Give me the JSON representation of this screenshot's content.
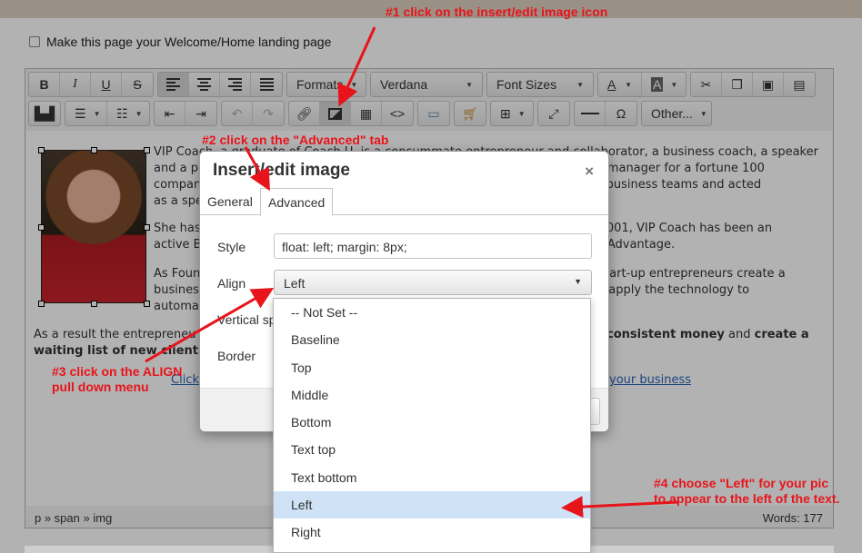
{
  "annotations": {
    "step1": "#1 click on the insert/edit image icon",
    "step2": "#2 click on the \"Advanced\" tab",
    "step3_line1": "#3 click on the ALIGN",
    "step3_line2": "pull down menu",
    "step4_line1": "#4 choose \"Left\" for your pic",
    "step4_line2": "to appear to the left of the text.",
    "color": "#e8141b"
  },
  "page": {
    "welcome_checkbox_label": "Make this page your Welcome/Home landing page"
  },
  "toolbar": {
    "formats_label": "Formats",
    "font_family_value": "Verdana",
    "font_sizes_label": "Font Sizes",
    "other_label": "Other...",
    "bold_label": "B",
    "italic_label": "I",
    "underline_label": "U",
    "strikethrough_label": "S",
    "text_color_label": "A",
    "bg_color_label": "A",
    "code_label": "<>",
    "special_char_label": "Ω"
  },
  "content": {
    "para1": "VIP Coach, a graduate of Coach U, is a consummate entrepreneur and collaborator, a business coach, a speaker and a p... orate HR manager for a fortune 100 compan... anaged business teams and acted as a spe...",
    "para1_lines": [
      "VIP Coach, a graduate of Coach U, is a consummate entrepreneur and collaborator, a business coach, a speaker",
      "and a p                                                                                              orate HR manager for a fortune 100",
      "compan                                                                                               anaged business teams and acted",
      "as a spe"
    ],
    "para2_lines": [
      "She has                                                                                                          2001, VIP Coach has been an",
      "active B                                                                                                         g Advantage."
    ],
    "para3_lines": [
      "As Foun                                                                                                          start-up entrepreneurs create a",
      "busines                                                                                                          d apply the technology to",
      "automa"
    ],
    "para4_start": "As a result the entrepreneu",
    "para4_bold1": "consistent money",
    "para4_mid": " and ",
    "para4_bold2": "create a",
    "para4_line2_bold": "waiting list of new clients",
    "link_left": "Click",
    "link_right": "your business"
  },
  "status": {
    "path": "p » span » img",
    "words": "Words: 177"
  },
  "dialog": {
    "title": "Insert/edit image",
    "close_glyph": "×",
    "tabs": [
      {
        "label": "General"
      },
      {
        "label": "Advanced"
      }
    ],
    "style_label": "Style",
    "style_value": "float: left; margin: 8px;",
    "align_label": "Align",
    "align_value": "Left",
    "vertical_label": "Vertical sp",
    "border_label": "Border"
  },
  "align_options": [
    "-- Not Set --",
    "Baseline",
    "Top",
    "Middle",
    "Bottom",
    "Text top",
    "Text bottom",
    "Left",
    "Right"
  ],
  "align_selected": "Left"
}
